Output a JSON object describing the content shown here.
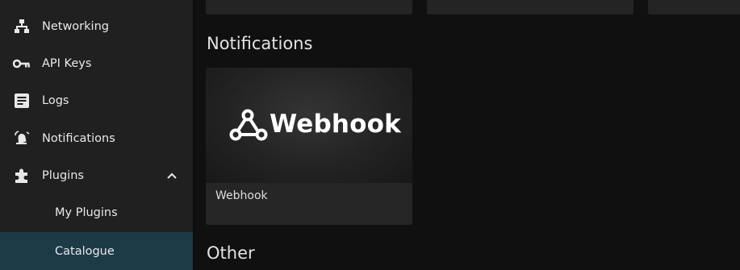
{
  "sidebar": {
    "items": [
      {
        "label": "Networking",
        "icon": "sitemap-icon"
      },
      {
        "label": "API Keys",
        "icon": "key-icon"
      },
      {
        "label": "Logs",
        "icon": "document-icon"
      },
      {
        "label": "Notifications",
        "icon": "bell-alert-icon"
      },
      {
        "label": "Plugins",
        "icon": "puzzle-icon",
        "expanded": true
      },
      {
        "label": "My Plugins",
        "sub": true
      },
      {
        "label": "Catalogue",
        "sub": true,
        "active": true
      }
    ]
  },
  "main": {
    "sections": [
      {
        "title": "Notifications"
      },
      {
        "title": "Other"
      }
    ],
    "cards": [
      {
        "logo_text": "Webhook",
        "caption": "Webhook"
      }
    ]
  },
  "colors": {
    "sidebar_bg": "#202020",
    "main_bg": "#101010",
    "active_bg": "#1d3a47",
    "card_bg": "#262626"
  }
}
